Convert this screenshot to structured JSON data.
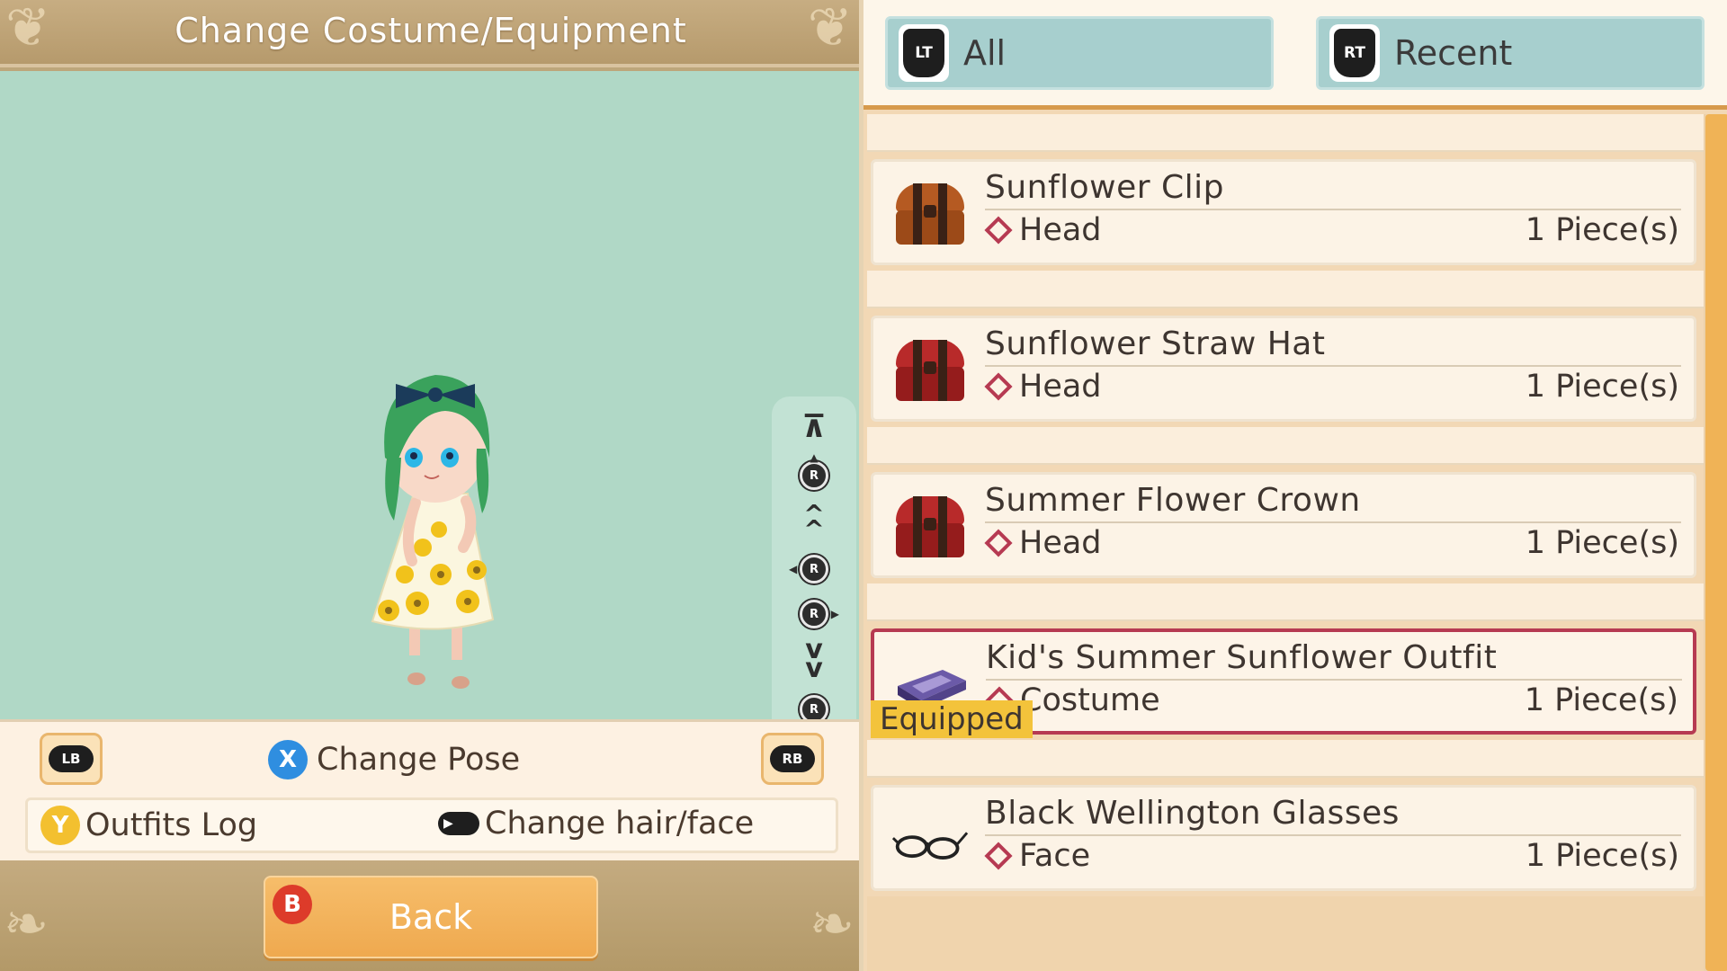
{
  "window": {
    "title": "Change Costume/Equipment"
  },
  "camera_controls": {
    "buttons": [
      "top",
      "up-stick",
      "up",
      "rotate-left",
      "rotate-right",
      "down",
      "down-stick",
      "bottom"
    ],
    "stick_letter": "R"
  },
  "controls": {
    "lb_label": "LB",
    "rb_label": "RB",
    "change_pose_button": "X",
    "change_pose_label": "Change Pose",
    "outfits_log_button": "Y",
    "outfits_log_label": "Outfits Log",
    "change_hair_label": "Change hair/face"
  },
  "back": {
    "button": "B",
    "label": "Back"
  },
  "tabs": [
    {
      "badge": "LT",
      "label": "All"
    },
    {
      "badge": "RT",
      "label": "Recent"
    }
  ],
  "equipped_tag": "Equipped",
  "items": [
    {
      "name": "Sunflower Clip",
      "type": "Head",
      "qty": "1 Piece(s)",
      "icon": "brown-chest-icon",
      "equipped": false
    },
    {
      "name": "Sunflower Straw Hat",
      "type": "Head",
      "qty": "1 Piece(s)",
      "icon": "red-chest-icon",
      "equipped": false
    },
    {
      "name": "Summer Flower Crown",
      "type": "Head",
      "qty": "1 Piece(s)",
      "icon": "red-chest-icon",
      "equipped": false
    },
    {
      "name": "Kid's Summer Sunflower Outfit",
      "type": "Costume",
      "qty": "1 Piece(s)",
      "icon": "purple-case-icon",
      "equipped": true
    },
    {
      "name": "Black Wellington Glasses",
      "type": "Face",
      "qty": "1 Piece(s)",
      "icon": "glasses-icon",
      "equipped": false
    }
  ],
  "colors": {
    "accent_orange": "#f0b356",
    "equipped_border": "#b63a52",
    "equipped_tag": "#f3c33b",
    "tab_bg": "#a7cfce",
    "preview_bg": "#b0d8c6",
    "x_button": "#2f8ee0",
    "y_button": "#f3c02f",
    "b_button": "#dd3b2a"
  }
}
